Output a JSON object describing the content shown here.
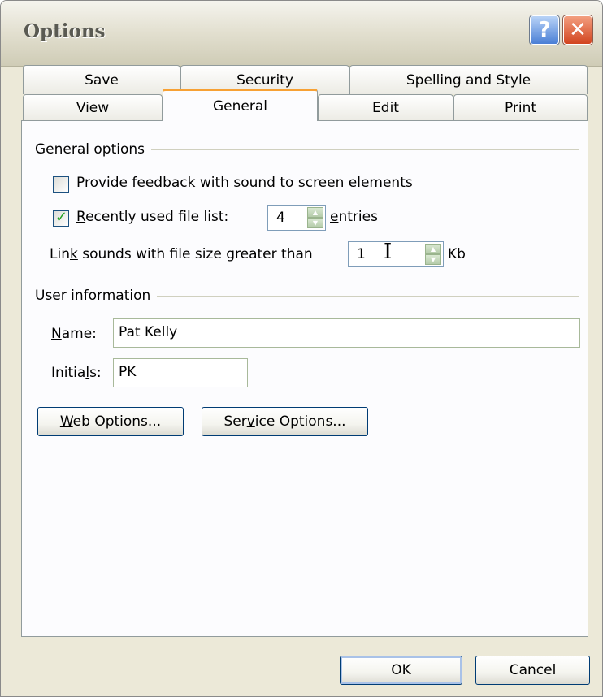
{
  "window": {
    "title": "Options"
  },
  "titlebar_buttons": {
    "help": "?",
    "close": "✕"
  },
  "tabs": {
    "back_row": [
      "Save",
      "Security",
      "Spelling and Style"
    ],
    "front_row": [
      "View",
      "General",
      "Edit",
      "Print"
    ],
    "active": "General"
  },
  "general_options": {
    "group_label": "General options",
    "feedback": {
      "label": "Provide feedback with sound to screen elements",
      "checked": false
    },
    "recent_files": {
      "label": "Recently used file list:",
      "checked": true,
      "value": "4",
      "suffix": "entries"
    },
    "link_sounds": {
      "label": "Link sounds with file size greater than",
      "value": "1",
      "suffix": "Kb"
    }
  },
  "user_information": {
    "group_label": "User information",
    "name_label": "Name:",
    "name_value": "Pat Kelly",
    "initials_label": "Initials:",
    "initials_value": "PK"
  },
  "buttons": {
    "web_options": "Web Options...",
    "service_options": "Service Options...",
    "ok": "OK",
    "cancel": "Cancel"
  }
}
